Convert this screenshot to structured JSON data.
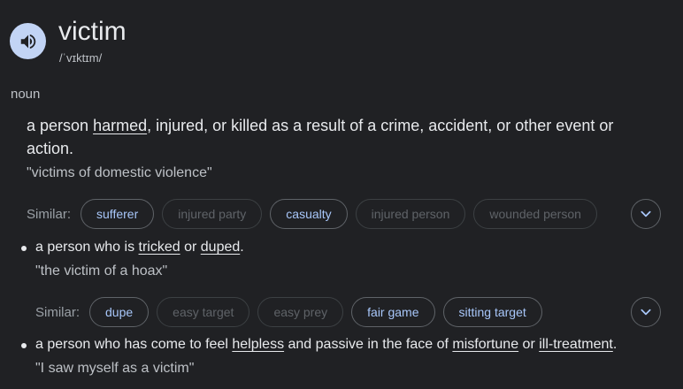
{
  "entry": {
    "word": "victim",
    "phonetic": "/ˈvɪktɪm/",
    "part_of_speech": "noun"
  },
  "icons": {
    "speaker": "speaker-icon",
    "expand": "chevron-down-icon"
  },
  "colors": {
    "background": "#202124",
    "speaker_bg": "#c2d4f5",
    "chip_active_text": "#a8c7fa"
  },
  "sense1": {
    "def_before": "a person ",
    "def_link1": "harmed",
    "def_after": ", injured, or killed as a result of a crime, accident, or other event or action.",
    "example": "\"victims of domestic violence\"",
    "similar_label": "Similar:",
    "similar": [
      "sufferer",
      "injured party",
      "casualty",
      "injured person",
      "wounded person"
    ]
  },
  "sense2": {
    "def_before": "a person who is ",
    "def_link1": "tricked",
    "def_mid": " or ",
    "def_link2": "duped",
    "def_after": ".",
    "example": "\"the victim of a hoax\"",
    "similar_label": "Similar:",
    "similar": [
      "dupe",
      "easy target",
      "easy prey",
      "fair game",
      "sitting target"
    ]
  },
  "sense3": {
    "def_before": "a person who has come to feel ",
    "def_link1": "helpless",
    "def_mid": " and passive in the face of ",
    "def_link2": "misfortune",
    "def_mid2": " or ",
    "def_link3": "ill-treatment",
    "def_after": ".",
    "example": "\"I saw myself as a victim\""
  }
}
